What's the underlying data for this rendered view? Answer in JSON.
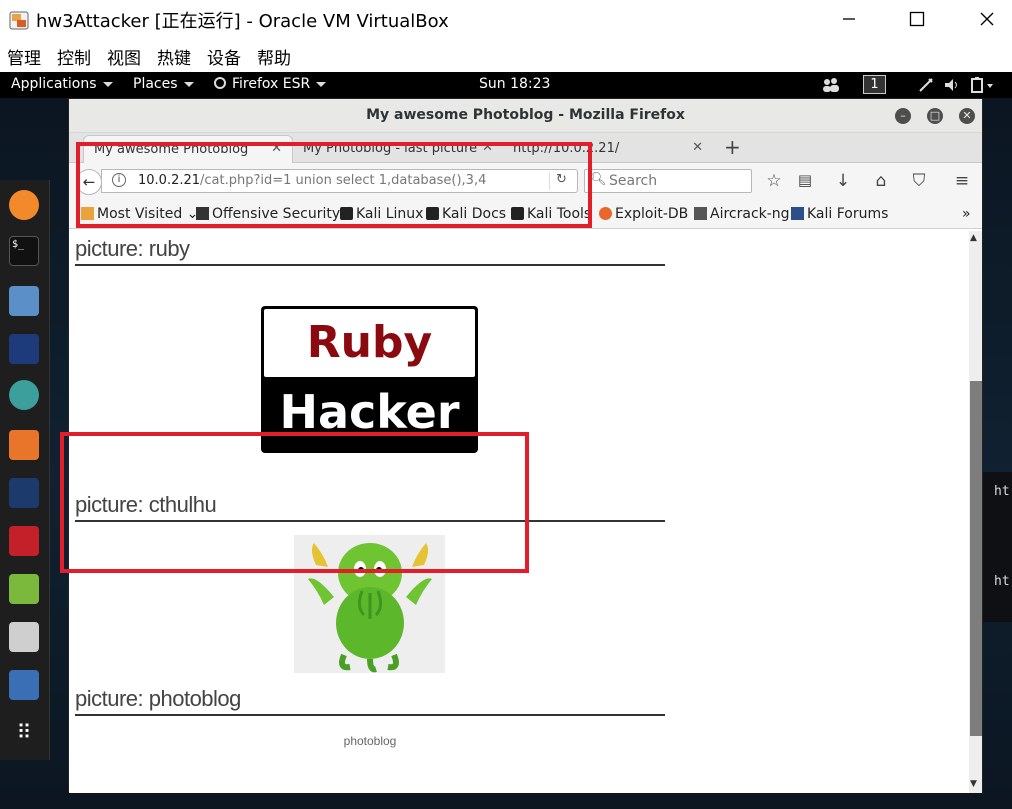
{
  "vbox": {
    "title": "hw3Attacker [正在运行] - Oracle VM VirtualBox",
    "menu": [
      "管理",
      "控制",
      "视图",
      "热键",
      "设备",
      "帮助"
    ]
  },
  "topbar": {
    "applications": "Applications",
    "places": "Places",
    "firefox": "Firefox ESR",
    "clock": "Sun 18:23",
    "workspace": "1"
  },
  "dock": {
    "icons": [
      "firefox-icon",
      "terminal-icon",
      "files-icon",
      "metasploit-icon",
      "armitage-icon",
      "burpsuite-icon",
      "maltego-icon",
      "faraday-icon",
      "leafpad-icon",
      "cutycapt-icon",
      "zaproxy-icon",
      "show-apps-icon"
    ]
  },
  "terminal_fragment": [
    "ht",
    "ht"
  ],
  "firefox": {
    "window_title": "My awesome Photoblog - Mozilla Firefox",
    "tabs": [
      {
        "label": "My awesome Photoblog",
        "active": true
      },
      {
        "label": "My Photoblog - last picture",
        "active": false
      },
      {
        "label": "http://10.0.2.21/",
        "active": false
      }
    ],
    "url_host": "10.0.2.21",
    "url_rest": "/cat.php?id=1 union select 1,database(),3,4",
    "search_placeholder": "Search",
    "bookmarks": [
      "Most Visited",
      "Offensive Security",
      "Kali Linux",
      "Kali Docs",
      "Kali Tools",
      "Exploit-DB",
      "Aircrack-ng",
      "Kali Forums"
    ]
  },
  "page": {
    "headings": [
      "picture: ruby",
      "picture: cthulhu",
      "picture: photoblog"
    ],
    "ruby_logo_top": "Ruby",
    "ruby_logo_bottom": "Hacker",
    "footer": "photoblog"
  },
  "colors": {
    "highlight": "#e01e2c",
    "kali_bg": "#0d1620"
  }
}
